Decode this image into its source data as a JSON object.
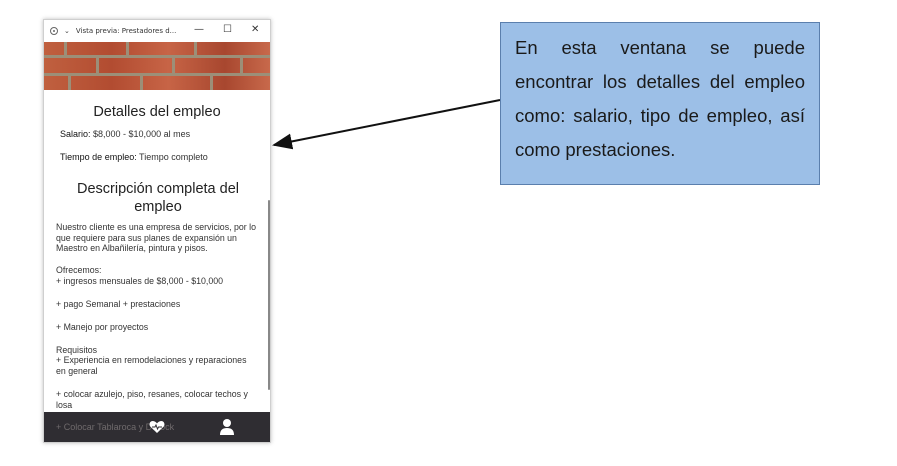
{
  "window": {
    "title": "Vista previa: Prestadores d...",
    "min_glyph": "—",
    "max_glyph": "☐",
    "close_glyph": "✕"
  },
  "details": {
    "heading": "Detalles del empleo",
    "salary_label": "Salario:",
    "salary_value": " $8,000 - $10,000 al mes",
    "type_label": "Tiempo de empleo:",
    "type_value": " Tiempo completo"
  },
  "description": {
    "heading": "Descripción completa del empleo",
    "intro": "Nuestro cliente es una empresa de servicios, por lo que requiere para sus planes de expansión un Maestro en Albañilería, pintura y pisos.",
    "offer_label": "Ofrecemos:",
    "offer_1": "+ ingresos mensuales de $8,000 - $10,000",
    "offer_2": "+ pago Semanal + prestaciones",
    "offer_3": "+ Manejo por proyectos",
    "req_label": "Requisitos",
    "req_1": "+ Experiencia en remodelaciones y reparaciones en general",
    "req_2": "+ colocar azulejo, piso, resanes, colocar techos y losa",
    "req_3_faded": "+ Colocar Tablaroca y Durock"
  },
  "nav": {
    "icons": [
      "heart-icon",
      "user-icon"
    ]
  },
  "callout": {
    "text": "En esta ventana se puede encontrar los detalles del empleo como: salario, tipo de empleo, así como prestaciones."
  },
  "colors": {
    "callout_bg": "#9cbfe7",
    "callout_border": "#5b7fad",
    "nav_bg": "#2f2d32",
    "brick": "#b8543a"
  }
}
